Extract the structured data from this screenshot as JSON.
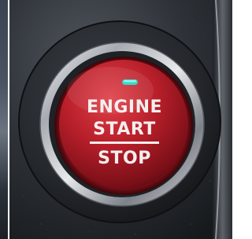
{
  "button": {
    "line1": "ENGINE",
    "line2": "START",
    "line3": "STOP"
  },
  "colors": {
    "button_red": "#b3202a",
    "indicator": "#39d7c8",
    "chrome": "#c9ccd1",
    "bezel": "#2a2e34"
  }
}
